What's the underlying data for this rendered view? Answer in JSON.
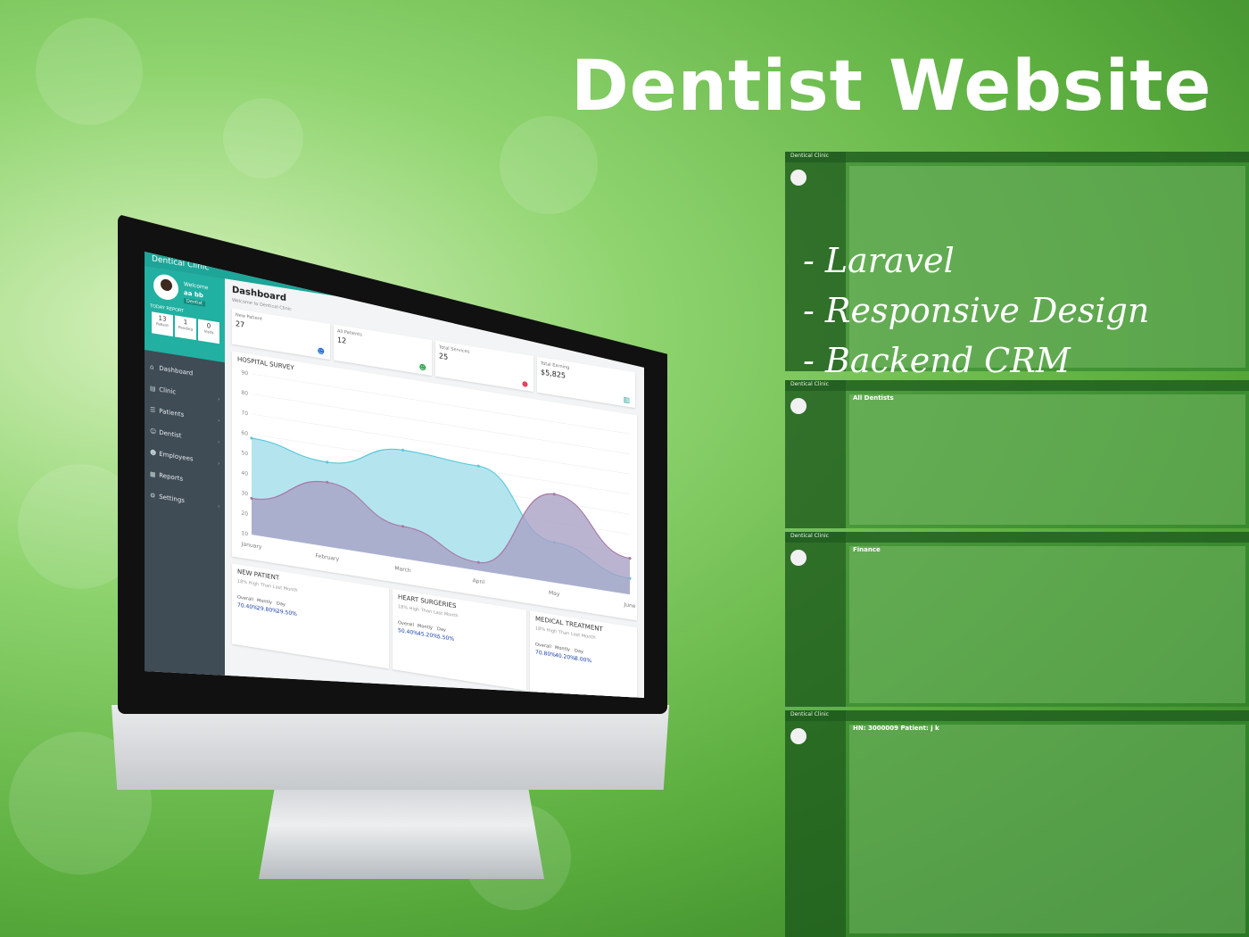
{
  "hero": {
    "title": "Dentist Website",
    "features": [
      "- Laravel",
      "- Responsive Design",
      "- Backend CRM"
    ]
  },
  "app": {
    "brand": "Dentical Clinic",
    "profile": {
      "welcome": "Welcome",
      "name": "aa bb",
      "role": "Dentist",
      "today_report": "TODAY REPORT",
      "stats": [
        {
          "value": "13",
          "label": "Patient"
        },
        {
          "value": "1",
          "label": "Pending"
        },
        {
          "value": "0",
          "label": "Visits"
        }
      ]
    },
    "nav": [
      {
        "icon": "home-icon",
        "glyph": "⌂",
        "label": "Dashboard",
        "has_sub": false
      },
      {
        "icon": "clinic-icon",
        "glyph": "▤",
        "label": "Clinic",
        "has_sub": true
      },
      {
        "icon": "patients-icon",
        "glyph": "☰",
        "label": "Patients",
        "has_sub": true
      },
      {
        "icon": "dentist-icon",
        "glyph": "☺",
        "label": "Dentist",
        "has_sub": true
      },
      {
        "icon": "employees-icon",
        "glyph": "☻",
        "label": "Employees",
        "has_sub": true
      },
      {
        "icon": "reports-icon",
        "glyph": "▦",
        "label": "Reports",
        "has_sub": false
      },
      {
        "icon": "settings-icon",
        "glyph": "⚙",
        "label": "Settings",
        "has_sub": true
      }
    ],
    "dashboard": {
      "title": "Dashboard",
      "subtitle": "Welcome to Dentical Clinic",
      "cards": [
        {
          "label": "New Patient",
          "value": "27",
          "icon": "user-icon",
          "color": "#1f6fd1"
        },
        {
          "label": "All Patients",
          "value": "12",
          "icon": "user-group-icon",
          "color": "#2fa84f"
        },
        {
          "label": "Total Services",
          "value": "25",
          "icon": "services-icon",
          "color": "#e04460"
        },
        {
          "label": "Total Earning",
          "value": "$5,825",
          "icon": "bank-icon",
          "color": "#1ca598"
        }
      ],
      "chart_title": "HOSPITAL SURVEY",
      "bottom_cards": [
        {
          "title": "NEW PATIENT",
          "subtitle": "18% High Than Last Month",
          "labels": [
            "Overall",
            "Montly",
            "Day"
          ],
          "values": [
            "70.40%",
            "29.80%",
            "29.50%"
          ]
        },
        {
          "title": "HEART SURGERIES",
          "subtitle": "18% High Than Last Month",
          "labels": [
            "Overall",
            "Montly",
            "Day"
          ],
          "values": [
            "50.40%",
            "45.20%",
            "5.50%"
          ]
        },
        {
          "title": "MEDICAL TREATMENT",
          "subtitle": "18% High Than Last Month",
          "labels": [
            "Overall",
            "Montly",
            "Day"
          ],
          "values": [
            "70.80%",
            "40.20%",
            "8.00%"
          ]
        }
      ]
    }
  },
  "chart_data": {
    "type": "area",
    "title": "HOSPITAL SURVEY",
    "x": [
      "January",
      "February",
      "March",
      "April",
      "May",
      "June"
    ],
    "ylim": [
      10,
      90
    ],
    "yticks": [
      10,
      20,
      30,
      40,
      50,
      60,
      70,
      80,
      90
    ],
    "series": [
      {
        "values": [
          58,
          52,
          64,
          62,
          30,
          18
        ],
        "color": "#5cc8db"
      },
      {
        "values": [
          28,
          42,
          26,
          14,
          54,
          28
        ],
        "color": "#a87aa6"
      }
    ],
    "grid": true,
    "legend": "none"
  },
  "collage": {
    "panels": [
      {
        "brand": "Dentical Clinic",
        "heading": ""
      },
      {
        "brand": "Dentical Clinic",
        "heading": "All Dentists"
      },
      {
        "brand": "Dentical Clinic",
        "heading": "Finance"
      },
      {
        "brand": "Dentical Clinic",
        "heading": "HN: 3000009 Patient: j k"
      }
    ]
  }
}
